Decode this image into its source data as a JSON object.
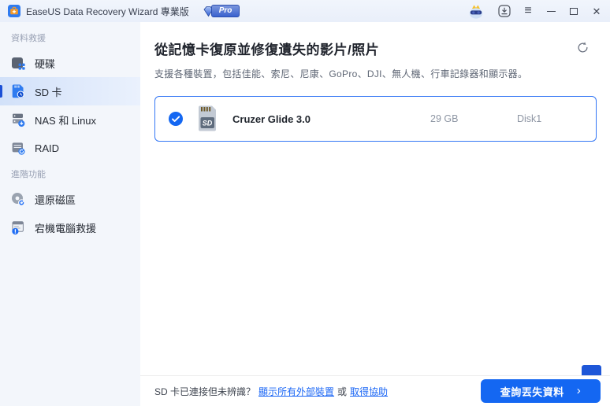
{
  "window": {
    "title": "EaseUS Data Recovery Wizard 專業版",
    "pro_badge": "Pro"
  },
  "titlebar": {
    "icons": {
      "app": "easeus-briefcase",
      "pro_diamond": "blue-diamond",
      "avatar": "vip-avatar-with-crown",
      "update": "arrow-down-box",
      "menu": "≡",
      "minimize": "—",
      "maximize": "□",
      "close": "✕"
    }
  },
  "sidebar": {
    "sections": [
      {
        "label": "資料救援",
        "items": [
          {
            "label": "硬碟",
            "icon": "hard-drive-icon",
            "selected": false
          },
          {
            "label": "SD 卡",
            "icon": "sd-card-icon",
            "selected": true
          },
          {
            "label": "NAS 和 Linux",
            "icon": "nas-linux-icon",
            "selected": false
          },
          {
            "label": "RAID",
            "icon": "raid-icon",
            "selected": false
          }
        ]
      },
      {
        "label": "進階功能",
        "items": [
          {
            "label": "還原磁區",
            "icon": "partition-recovery-icon",
            "selected": false
          },
          {
            "label": "宕機電腦救援",
            "icon": "crashed-pc-icon",
            "selected": false
          }
        ]
      }
    ]
  },
  "main": {
    "title": "從記憶卡復原並修復遺失的影片/照片",
    "subtitle": "支援各種裝置，包括佳能、索尼、尼康、GoPro、DJI、無人機、行車記錄器和顯示器。",
    "refresh_icon": "refresh-circular-arrow",
    "device": {
      "selected": true,
      "check_icon": "blue-check-circle",
      "device_icon": "sd-memory-card",
      "name": "Cruzer Glide 3.0",
      "size": "29 GB",
      "disk": "Disk1"
    }
  },
  "footer": {
    "question": "SD 卡已連接但未辨識？",
    "link_show_devices": "顯示所有外部裝置",
    "or_text": "或",
    "link_help": "取得協助",
    "scan_button": "查詢丟失資料",
    "chevron": "›"
  },
  "colors": {
    "accent_blue": "#1467f2",
    "link_blue": "#1a66f5",
    "card_border": "#3477f5",
    "sidebar_bg": "#f3f6fb",
    "selected_item_bg": "#d2e1f9",
    "titlebar_bg": "#eef3fb"
  }
}
